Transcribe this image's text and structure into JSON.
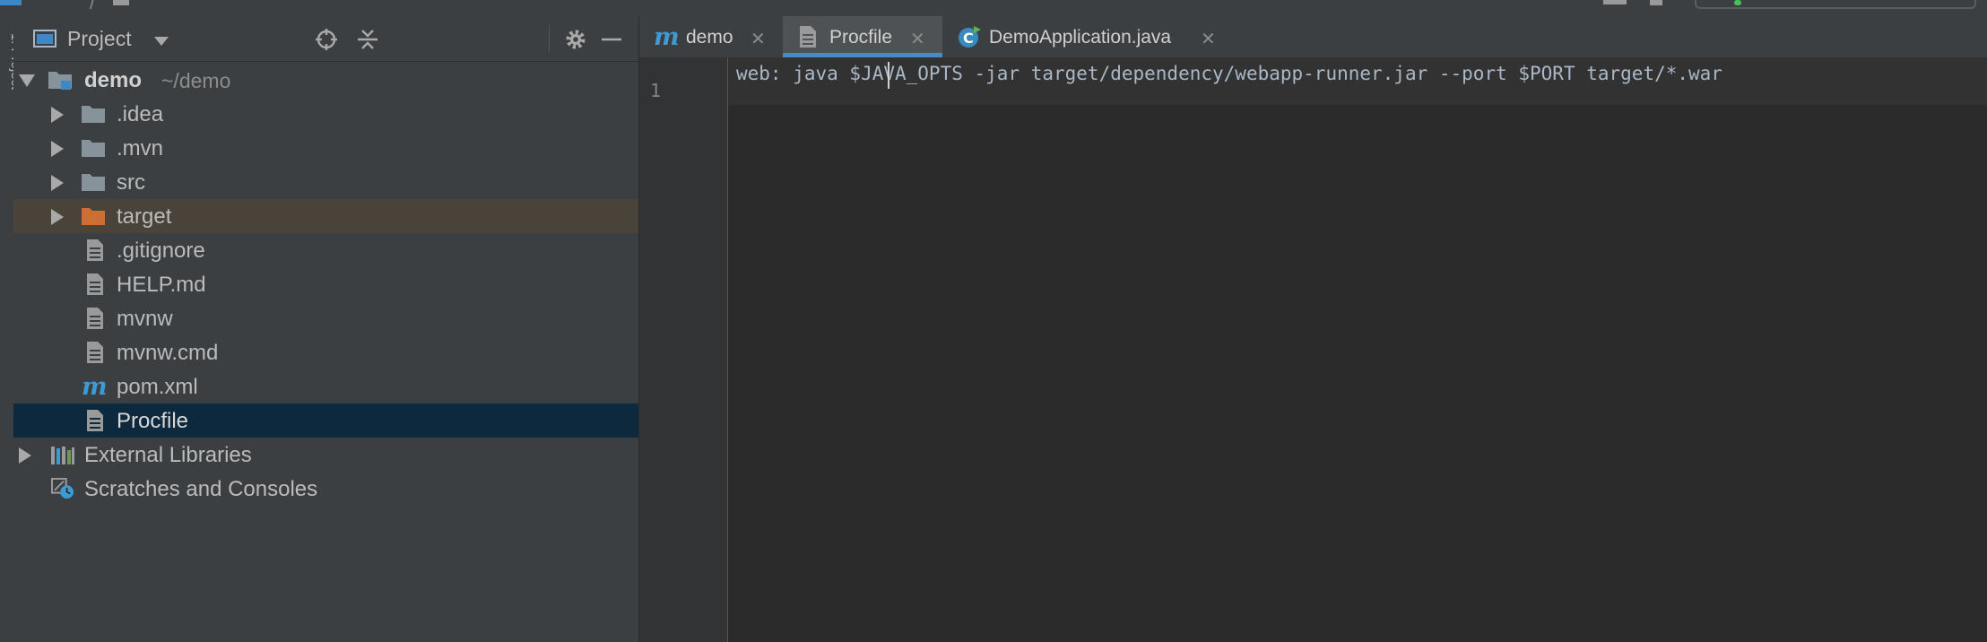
{
  "colors": {
    "panel_bg": "#3c3f41",
    "editor_bg": "#2b2b2b",
    "selection": "#0d293e",
    "target_row": "#4a4339",
    "accent": "#4a88c7",
    "folder": "#87939a",
    "excluded_folder": "#cc6f35",
    "maven": "#3d9bd4"
  },
  "tool_window": {
    "label": "1: Project"
  },
  "project_panel": {
    "title": "Project",
    "icons": [
      "locate-icon",
      "collapse-all-icon",
      "gear-icon",
      "minimize-icon"
    ]
  },
  "tree": {
    "root": {
      "name": "demo",
      "path": "~/demo"
    },
    "items": [
      {
        "label": ".idea",
        "kind": "folder"
      },
      {
        "label": ".mvn",
        "kind": "folder"
      },
      {
        "label": "src",
        "kind": "folder"
      },
      {
        "label": "target",
        "kind": "excluded-folder"
      },
      {
        "label": ".gitignore",
        "kind": "file"
      },
      {
        "label": "HELP.md",
        "kind": "file"
      },
      {
        "label": "mvnw",
        "kind": "file"
      },
      {
        "label": "mvnw.cmd",
        "kind": "file"
      },
      {
        "label": "pom.xml",
        "kind": "maven"
      },
      {
        "label": "Procfile",
        "kind": "file",
        "selected": true
      }
    ],
    "external_libraries": "External Libraries",
    "scratches": "Scratches and Consoles"
  },
  "tabs": [
    {
      "label": "demo",
      "icon": "maven-icon"
    },
    {
      "label": "Procfile",
      "icon": "file-icon",
      "active": true
    },
    {
      "label": "DemoApplication.java",
      "icon": "java-class-icon"
    }
  ],
  "editor": {
    "line_number": "1",
    "code": "web: java $JAVA_OPTS -jar target/dependency/webapp-runner.jar --port $PORT target/*.war"
  }
}
